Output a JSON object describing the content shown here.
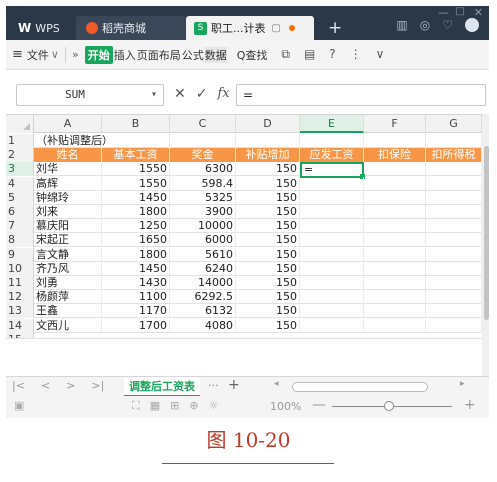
{
  "titlebar": {
    "wps_label": "WPS",
    "store_tab": "稻壳商城",
    "doc_tab": "职工...计表",
    "add_label": "+"
  },
  "menubar": {
    "file_label": "文件",
    "start_label": "开始",
    "items": [
      "插入",
      "页面布局",
      "公式",
      "数据"
    ],
    "search_label": "Q查找"
  },
  "formulabar": {
    "name_box_value": "SUM",
    "fx_label": "fx",
    "formula_value": "="
  },
  "grid": {
    "columns": [
      "A",
      "B",
      "C",
      "D",
      "E",
      "F",
      "G"
    ],
    "selected_column": "E",
    "selected_row": "3",
    "title_cell": "（补贴调整后）",
    "headers": [
      "姓名",
      "基本工资",
      "奖金",
      "补贴增加",
      "应发工资",
      "扣保险",
      "扣所得税"
    ],
    "rows": [
      {
        "n": "3",
        "name": "刘华",
        "base": "1550",
        "bonus": "6300",
        "sub": "150",
        "pay": "="
      },
      {
        "n": "4",
        "name": "高辉",
        "base": "1550",
        "bonus": "598.4",
        "sub": "150",
        "pay": ""
      },
      {
        "n": "5",
        "name": "钟绵玲",
        "base": "1450",
        "bonus": "5325",
        "sub": "150",
        "pay": ""
      },
      {
        "n": "6",
        "name": "刘来",
        "base": "1800",
        "bonus": "3900",
        "sub": "150",
        "pay": ""
      },
      {
        "n": "7",
        "name": "慕庆阳",
        "base": "1250",
        "bonus": "10000",
        "sub": "150",
        "pay": ""
      },
      {
        "n": "8",
        "name": "宋起正",
        "base": "1650",
        "bonus": "6000",
        "sub": "150",
        "pay": ""
      },
      {
        "n": "9",
        "name": "言文静",
        "base": "1800",
        "bonus": "5610",
        "sub": "150",
        "pay": ""
      },
      {
        "n": "10",
        "name": "齐乃风",
        "base": "1450",
        "bonus": "6240",
        "sub": "150",
        "pay": ""
      },
      {
        "n": "11",
        "name": "刘勇",
        "base": "1430",
        "bonus": "14000",
        "sub": "150",
        "pay": ""
      },
      {
        "n": "12",
        "name": "杨颜萍",
        "base": "1100",
        "bonus": "6292.5",
        "sub": "150",
        "pay": ""
      },
      {
        "n": "13",
        "name": "王鑫",
        "base": "1170",
        "bonus": "6132",
        "sub": "150",
        "pay": ""
      },
      {
        "n": "14",
        "name": "文西儿",
        "base": "1700",
        "bonus": "4080",
        "sub": "150",
        "pay": ""
      }
    ],
    "row_numbers_top": [
      "1",
      "2"
    ],
    "partial_row": "15"
  },
  "sheetbar": {
    "sheet_name": "调整后工资表",
    "more_label": "···",
    "add_label": "+"
  },
  "statusbar": {
    "zoom": "100%",
    "zoom_minus": "—",
    "zoom_plus": "+"
  },
  "caption": "图 10-20",
  "colors": {
    "titlebar_bg": "#2b3848",
    "header_fill": "#f79646",
    "accent_green": "#1aa55d",
    "caption_red": "#c0392b"
  }
}
